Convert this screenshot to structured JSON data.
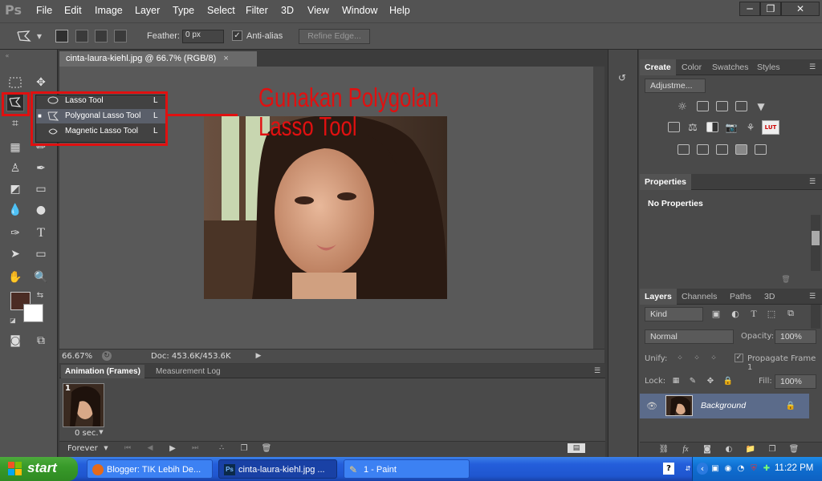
{
  "app": {
    "logo": "Ps"
  },
  "menubar": {
    "items": [
      "File",
      "Edit",
      "Image",
      "Layer",
      "Type",
      "Select",
      "Filter",
      "3D",
      "View",
      "Window",
      "Help"
    ]
  },
  "window_controls": {
    "minimize": "─",
    "restore": "❐",
    "close": "✕"
  },
  "options_bar": {
    "feather_label": "Feather:",
    "feather_value": "0 px",
    "antialias_label": "Anti-alias",
    "antialias_checked": true,
    "refine_edge_label": "Refine Edge..."
  },
  "tool_flyout": {
    "items": [
      {
        "label": "Lasso Tool",
        "shortcut": "L",
        "selected": false
      },
      {
        "label": "Polygonal Lasso Tool",
        "shortcut": "L",
        "selected": true
      },
      {
        "label": "Magnetic Lasso Tool",
        "shortcut": "L",
        "selected": false
      }
    ]
  },
  "annotation": {
    "line1": "Gunakan Polygolan",
    "line2": "Lasso Tool",
    "color": "#e01010"
  },
  "document": {
    "tab_title": "cinta-laura-kiehl.jpg @ 66.7% (RGB/8)",
    "tab_close": "×",
    "zoom": "66.67%",
    "doc_size": "Doc: 453.6K/453.6K"
  },
  "animation_panel": {
    "tabs": [
      "Animation (Frames)",
      "Measurement Log"
    ],
    "frame_number": "1",
    "frame_delay": "0 sec.",
    "loop": "Forever"
  },
  "right_panels": {
    "adjust_tabs": [
      "Create",
      "Color",
      "Swatches",
      "Styles"
    ],
    "adjust_dropdown": "Adjustme...",
    "properties_title": "Properties",
    "properties_text": "No Properties",
    "layers_tabs": [
      "Layers",
      "Channels",
      "Paths",
      "3D"
    ],
    "kind_label": "Kind",
    "blend_mode": "Normal",
    "opacity_label": "Opacity:",
    "opacity_value": "100%",
    "unify_label": "Unify:",
    "propagate_label": "Propagate Frame 1",
    "lock_label": "Lock:",
    "fill_label": "Fill:",
    "fill_value": "100%",
    "layer_name": "Background"
  },
  "taskbar": {
    "start_label": "start",
    "tasks": [
      "Blogger: TIK Lebih De...",
      "cinta-laura-kiehl.jpg ...",
      "1 - Paint"
    ],
    "clock": "11:22 PM"
  },
  "colors": {
    "ps_bg": "#535353",
    "accent_red": "#e01010",
    "xp_blue": "#245edb"
  }
}
